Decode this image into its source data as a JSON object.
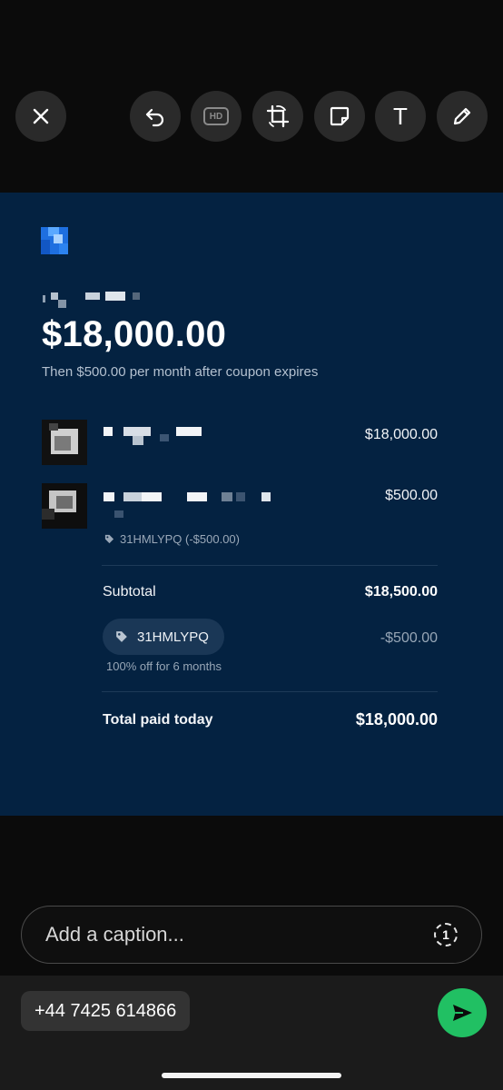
{
  "toolbar": {
    "close_icon": "close-icon",
    "undo_icon": "undo-icon",
    "hd_label": "HD",
    "crop_icon": "crop-rotate-icon",
    "sticker_icon": "sticker-icon",
    "text_tool_label": "T",
    "pen_icon": "pencil-icon"
  },
  "receipt": {
    "amount": "$18,000.00",
    "subtitle": "Then $500.00 per month after coupon expires",
    "items": [
      {
        "price": "$18,000.00"
      },
      {
        "price": "$500.00",
        "coupon": "31HMLYPQ (-$500.00)"
      }
    ],
    "subtotal_label": "Subtotal",
    "subtotal_value": "$18,500.00",
    "coupon_code": "31HMLYPQ",
    "coupon_discount": "-$500.00",
    "coupon_note": "100% off for 6 months",
    "total_label": "Total paid today",
    "total_value": "$18,000.00",
    "accent_color": "#042241"
  },
  "caption": {
    "placeholder": "Add a caption...",
    "view_once_label": "1"
  },
  "recipient": {
    "label": "+44 7425 614866"
  },
  "send_color": "#21c063"
}
